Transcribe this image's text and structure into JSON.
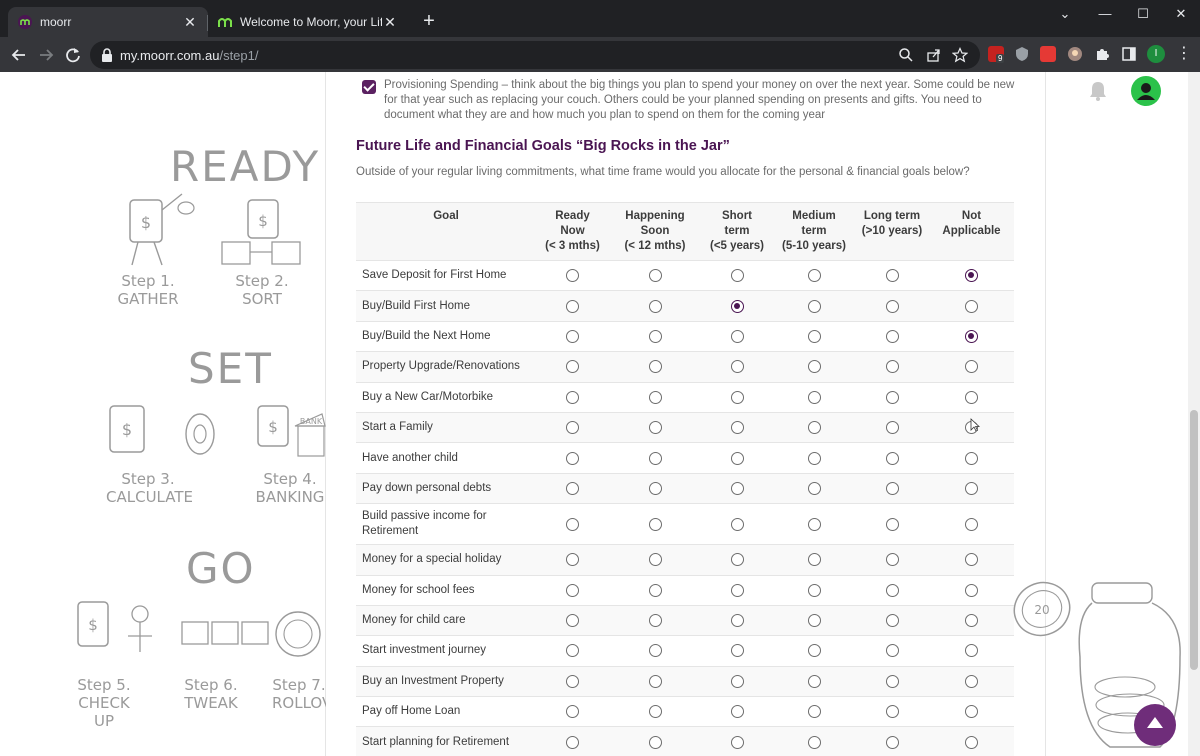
{
  "browser": {
    "tabs": [
      {
        "title": "moorr",
        "active": true
      },
      {
        "title": "Welcome to Moorr, your Lifestyle by",
        "active": false
      }
    ],
    "new_tab": "+",
    "url_host": "my.moorr.com.au",
    "url_path": "/step1/",
    "extension_badge": "9",
    "profile_initial": "I",
    "window_controls": {
      "minimize": "—",
      "maximize": "☐",
      "close": "✕",
      "tab_search": "⌄"
    }
  },
  "sidebar": {
    "stages": [
      {
        "word": "READY",
        "steps": [
          {
            "label": "Step 1.",
            "name": "GATHER"
          },
          {
            "label": "Step 2.",
            "name": "SORT"
          }
        ]
      },
      {
        "word": "SET",
        "steps": [
          {
            "label": "Step 3.",
            "name": "CALCULATE"
          },
          {
            "label": "Step 4.",
            "name": "BANKING"
          }
        ]
      },
      {
        "word": "GO",
        "steps": [
          {
            "label": "Step 5.",
            "name": "CHECK UP"
          },
          {
            "label": "Step 6.",
            "name": "TWEAK"
          },
          {
            "label": "Step 7.",
            "name": "ROLLOVER"
          }
        ]
      }
    ]
  },
  "main": {
    "provisioning_text": "Provisioning Spending – think about the big things you plan to spend your money on over the next year. Some could be new for that year such as replacing your couch. Others could be your planned spending on presents and gifts. You need to document what they are and how much you plan to spend on them for the coming year",
    "provisioning_checked": true,
    "section_title": "Future Life and Financial Goals “Big Rocks in the Jar”",
    "section_subtitle": "Outside of your regular living commitments, what time frame would you allocate for the personal & financial goals below?",
    "table": {
      "columns": [
        "Goal",
        "Ready Now (< 3 mths)",
        "Happening Soon (< 12 mths)",
        "Short term (<5 years)",
        "Medium term (5-10 years)",
        "Long term (>10 years)",
        "Not Applicable"
      ],
      "column_lines": [
        [
          "Goal"
        ],
        [
          "Ready",
          "Now",
          "(< 3 mths)"
        ],
        [
          "Happening",
          "Soon",
          "(< 12 mths)"
        ],
        [
          "Short",
          "term",
          "(<5 years)"
        ],
        [
          "Medium",
          "term",
          "(5-10 years)"
        ],
        [
          "Long term",
          "(>10 years)"
        ],
        [
          "Not",
          "Applicable"
        ]
      ],
      "rows": [
        {
          "goal": "Save Deposit for First Home",
          "selected": 5
        },
        {
          "goal": "Buy/Build First Home",
          "selected": 2
        },
        {
          "goal": "Buy/Build the Next Home",
          "selected": 5
        },
        {
          "goal": "Property Upgrade/Renovations",
          "selected": -1
        },
        {
          "goal": "Buy a New Car/Motorbike",
          "selected": -1
        },
        {
          "goal": "Start a Family",
          "selected": -1
        },
        {
          "goal": "Have another child",
          "selected": -1
        },
        {
          "goal": "Pay down personal debts",
          "selected": -1
        },
        {
          "goal": "Build passive income for Retirement",
          "selected": -1
        },
        {
          "goal": "Money for a special holiday",
          "selected": -1
        },
        {
          "goal": "Money for school fees",
          "selected": -1
        },
        {
          "goal": "Money for child care",
          "selected": -1
        },
        {
          "goal": "Start investment journey",
          "selected": -1
        },
        {
          "goal": "Buy an Investment Property",
          "selected": -1
        },
        {
          "goal": "Pay off Home Loan",
          "selected": -1
        },
        {
          "goal": "Start planning for Retirement",
          "selected": -1
        }
      ]
    }
  },
  "colors": {
    "brand_purple": "#4a1552",
    "fab_purple": "#6f2d7a",
    "avatar_green": "#2bc24a"
  }
}
